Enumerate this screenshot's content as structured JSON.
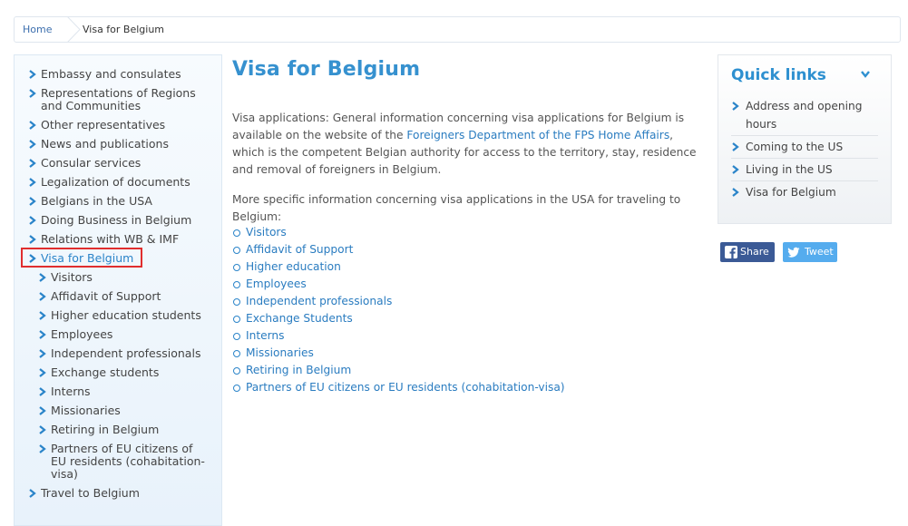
{
  "breadcrumb": {
    "home": "Home",
    "current": "Visa for Belgium"
  },
  "leftnav": {
    "items": [
      {
        "label": "Embassy and consulates"
      },
      {
        "label": "Representations of Regions and Communities"
      },
      {
        "label": "Other representatives"
      },
      {
        "label": "News and publications"
      },
      {
        "label": "Consular services"
      },
      {
        "label": "Legalization of documents"
      },
      {
        "label": "Belgians in the USA"
      },
      {
        "label": "Doing Business in Belgium"
      },
      {
        "label": "Relations with WB & IMF"
      },
      {
        "label": "Visa for Belgium"
      },
      {
        "label": "Visitors"
      },
      {
        "label": "Affidavit of Support"
      },
      {
        "label": "Higher education students"
      },
      {
        "label": "Employees"
      },
      {
        "label": "Independent professionals"
      },
      {
        "label": "Exchange students"
      },
      {
        "label": "Interns"
      },
      {
        "label": "Missionaries"
      },
      {
        "label": "Retiring in Belgium"
      },
      {
        "label": "Partners of EU citizens of EU residents (cohabitation-visa)"
      },
      {
        "label": "Travel to Belgium"
      }
    ]
  },
  "main": {
    "title": "Visa for Belgium",
    "para1_before": "Visa applications: General information concerning visa applications for Belgium is available on the website of the ",
    "para1_link": "Foreigners Department of the FPS Home Affairs",
    "para1_after": ", which is the competent Belgian authority for access to the territory, stay, residence and removal of foreigners in Belgium.",
    "para2": "More specific information concerning visa applications in the USA for traveling to Belgium:",
    "links": [
      "Visitors",
      "Affidavit of Support",
      "Higher education",
      "Employees",
      "Independent professionals",
      "Exchange Students",
      "Interns",
      "Missionaries",
      "Retiring in Belgium",
      "Partners of EU citizens or EU residents (cohabitation-visa)"
    ]
  },
  "quicklinks": {
    "title": "Quick links",
    "items": [
      "Address and opening hours",
      "Coming to the US",
      "Living in the US",
      "Visa for Belgium"
    ]
  },
  "share": {
    "facebook": "Share",
    "twitter": "Tweet"
  },
  "icons": {
    "nav_arrow": "chevron-right-icon",
    "quick_chevron": "chevron-down-icon",
    "facebook": "facebook-icon",
    "twitter": "twitter-icon"
  },
  "colors": {
    "accent": "#3691cf",
    "link": "#2a7cc0",
    "active_outline": "#e02e2e",
    "facebook": "#3b5a96",
    "twitter": "#55acee"
  }
}
